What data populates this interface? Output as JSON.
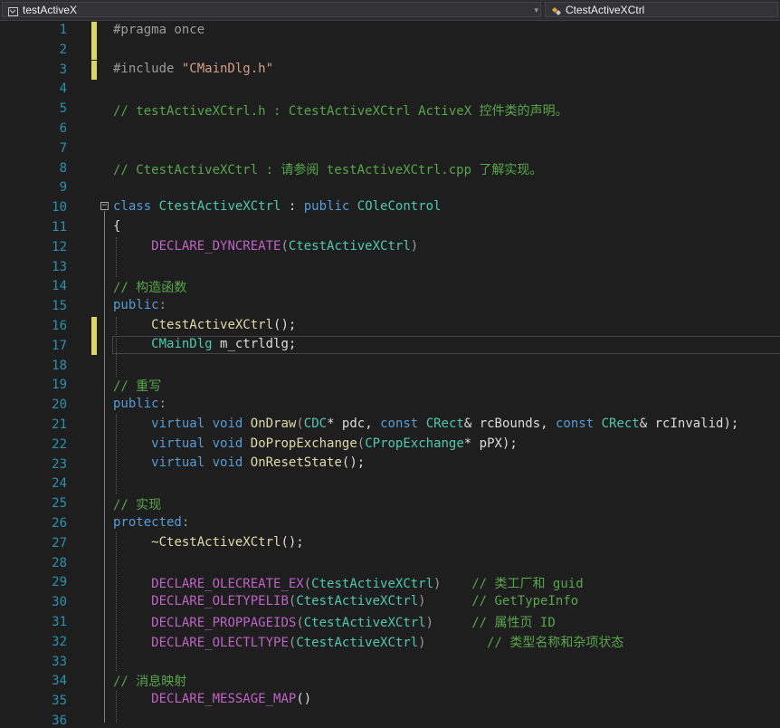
{
  "toolbar": {
    "left_combo": "testActiveX",
    "right_combo": "CtestActiveXCtrl",
    "dropdown_arrow": "▾"
  },
  "line_numbers": [
    "1",
    "2",
    "3",
    "4",
    "5",
    "6",
    "7",
    "8",
    "9",
    "10",
    "11",
    "12",
    "13",
    "14",
    "15",
    "16",
    "17",
    "18",
    "19",
    "20",
    "21",
    "22",
    "23",
    "24",
    "25",
    "26",
    "27",
    "28",
    "29",
    "30",
    "31",
    "32",
    "33",
    "34",
    "35",
    "36"
  ],
  "code": {
    "l1": "#pragma once",
    "l3_pre": "#include ",
    "l3_str": "\"CMainDlg.h\"",
    "l5": "// testActiveXCtrl.h : CtestActiveXCtrl ActiveX 控件类的声明。",
    "l8": "// CtestActiveXCtrl : 请参阅 testActiveXCtrl.cpp 了解实现。",
    "l10_class": "class",
    "l10_name": "CtestActiveXCtrl",
    "l10_mid": " : ",
    "l10_public": "public",
    "l10_base": "COleControl",
    "l11": "{",
    "l12_macro": "DECLARE_DYNCREATE",
    "l12_arg": "CtestActiveXCtrl",
    "l14": "// 构造函数",
    "l15_kw": "public",
    "l15_colon": ":",
    "l16_fn": "CtestActiveXCtrl",
    "l16_rest": "();",
    "l17_type": "CMainDlg",
    "l17_rest": " m_ctrldlg;",
    "l19": "// 重写",
    "l20_kw": "public",
    "l20_colon": ":",
    "l21": {
      "virtual": "virtual",
      "void": "void",
      "fn": "OnDraw",
      "p1type": "CDC",
      "p1": "* pdc, ",
      "const1": "const",
      "p2type": "CRect",
      "p2": "& rcBounds, ",
      "const2": "const",
      "p3type": "CRect",
      "p3": "& rcInvalid);"
    },
    "l22": {
      "virtual": "virtual",
      "void": "void",
      "fn": "DoPropExchange",
      "ptype": "CPropExchange",
      "rest": "* pPX);"
    },
    "l23": {
      "virtual": "virtual",
      "void": "void",
      "fn": "OnResetState",
      "rest": "();"
    },
    "l25": "// 实现",
    "l26_kw": "protected",
    "l26_colon": ":",
    "l27_fn": "~CtestActiveXCtrl",
    "l27_rest": "();",
    "l29": {
      "macro": "DECLARE_OLECREATE_EX",
      "arg": "CtestActiveXCtrl",
      "comment": "// 类工厂和 guid"
    },
    "l30": {
      "macro": "DECLARE_OLETYPELIB",
      "arg": "CtestActiveXCtrl",
      "comment": "// GetTypeInfo"
    },
    "l31": {
      "macro": "DECLARE_PROPPAGEIDS",
      "arg": "CtestActiveXCtrl",
      "comment": "// 属性页 ID"
    },
    "l32": {
      "macro": "DECLARE_OLECTLTYPE",
      "arg": "CtestActiveXCtrl",
      "comment": "// 类型名称和杂项状态"
    },
    "l34": "// 消息映射",
    "l35_macro": "DECLARE_MESSAGE_MAP",
    "l35_rest": "()"
  },
  "colors": {
    "background": "#1e1e1e",
    "keyword": "#569cd6",
    "type": "#4ec9b0",
    "function": "#dcdcaa",
    "macro": "#bd63c5",
    "comment": "#57a64a",
    "string": "#d69d85",
    "line_number": "#2b91af",
    "change_marker": "#d9d467"
  }
}
